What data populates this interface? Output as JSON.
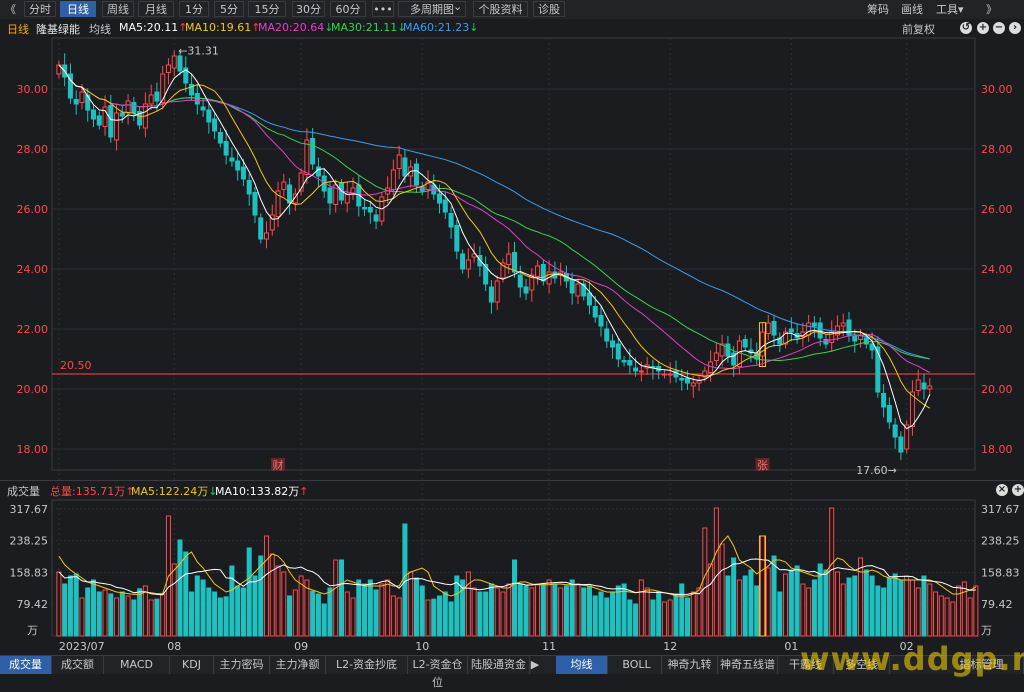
{
  "toolbar": {
    "back_glyph": "《",
    "tabs": [
      "分时",
      "日线",
      "周线",
      "月线",
      "1分",
      "5分",
      "15分",
      "30分",
      "60分",
      "•••",
      "多周期图",
      "个股资料",
      "诊股"
    ],
    "active_tab": 1,
    "dropdown_glyph": "⌄",
    "right_items": [
      "筹码",
      "画线",
      "工具"
    ],
    "tools_caret": "▾",
    "forward_glyph": "》"
  },
  "info": {
    "period": "日线",
    "name": "隆基绿能",
    "ma_label": "均线",
    "ma": [
      {
        "label": "MA5:20.11",
        "arrow": "↑",
        "color": "#ffffff",
        "arrow_color": "#ff3b3b"
      },
      {
        "label": "MA10:19.61",
        "arrow": "↑",
        "color": "#f5c518",
        "arrow_color": "#ff3b3b"
      },
      {
        "label": "MA20:20.64",
        "arrow": "↓",
        "color": "#e040c8",
        "arrow_color": "#22c55e"
      },
      {
        "label": "MA30:21.11",
        "arrow": "↓",
        "color": "#3ccf4e",
        "arrow_color": "#22c55e"
      },
      {
        "label": "MA60:21.23",
        "arrow": "↓",
        "color": "#3b9bf0",
        "arrow_color": "#22c55e"
      }
    ],
    "adjust": "前复权",
    "ctrl_icons": [
      "↺",
      "+",
      "−",
      "›"
    ]
  },
  "volume_info": {
    "label": "成交量",
    "total": "总量:135.71万",
    "total_arrow": "↑",
    "ma5": "MA5:122.24万",
    "ma5_arrow": "↓",
    "ma10": "MA10:133.82万",
    "ma10_arrow": "↑",
    "ctrl_icons": [
      "×",
      "+"
    ]
  },
  "bottom_tabs": {
    "left": [
      "成交量",
      "成交额",
      "MACD",
      "KDJ",
      "主力密码",
      "主力净额",
      "L2-资金抄底",
      "L2-资金仓位",
      "陆股通资金"
    ],
    "left_active": 0,
    "right": [
      "均线",
      "BOLL",
      "神奇九转",
      "神奇五线谱",
      "干霸线",
      "多空线",
      "指标管理"
    ],
    "right_active": 0,
    "arrow": "▶"
  },
  "watermark": "www.ddgp.net",
  "colors": {
    "up": "#ff4848",
    "down": "#1ec0c0",
    "grid": "#2d2e33",
    "axis_text_price": "#ff4848",
    "axis_text_vol": "#c8c8c8"
  },
  "chart_data": [
    {
      "type": "candlestick",
      "y_ticks": [
        18.0,
        20.0,
        22.0,
        24.0,
        26.0,
        28.0,
        30.0
      ],
      "ylim": [
        17.3,
        31.7
      ],
      "x_tick_labels": [
        "2023/07",
        "08",
        "09",
        "10",
        "11",
        "12",
        "01",
        "02"
      ],
      "x_tick_positions": [
        0,
        20,
        42,
        63,
        85,
        106,
        127,
        147
      ],
      "n_bars": 159,
      "high_label": "31.31",
      "low_label": "17.60",
      "ref_line": {
        "value": 20.5,
        "label": "20.50"
      },
      "event_markers": [
        {
          "bar": 38,
          "label": "财"
        },
        {
          "bar": 122,
          "label": "张"
        }
      ],
      "highlight_bar": 122,
      "closes": [
        30.8,
        30.4,
        29.7,
        29.5,
        29.9,
        29.3,
        29.0,
        28.8,
        29.4,
        28.4,
        29.2,
        29.1,
        29.6,
        29.2,
        28.8,
        29.5,
        29.8,
        29.6,
        30.5,
        30.8,
        31.1,
        30.6,
        30.2,
        29.8,
        29.5,
        29.3,
        28.9,
        28.6,
        28.2,
        27.8,
        27.6,
        27.3,
        27.0,
        26.5,
        25.8,
        25.0,
        25.2,
        25.8,
        26.6,
        26.9,
        26.2,
        26.5,
        27.2,
        28.3,
        27.5,
        27.1,
        26.6,
        26.2,
        26.8,
        26.3,
        26.5,
        26.7,
        26.1,
        26.0,
        25.9,
        25.6,
        26.4,
        26.7,
        27.3,
        27.8,
        27.1,
        27.4,
        26.8,
        26.6,
        26.9,
        26.5,
        26.2,
        25.9,
        25.4,
        24.6,
        24.0,
        24.3,
        24.5,
        24.1,
        23.5,
        22.9,
        23.6,
        24.2,
        24.5,
        23.9,
        23.4,
        23.2,
        23.8,
        24.1,
        23.6,
        23.9,
        23.7,
        23.9,
        23.6,
        23.2,
        23.5,
        23.1,
        22.8,
        22.4,
        22.1,
        21.6,
        21.4,
        21.0,
        20.9,
        20.8,
        20.6,
        20.6,
        20.8,
        20.7,
        20.6,
        20.5,
        20.5,
        20.4,
        20.3,
        20.2,
        20.2,
        20.3,
        20.6,
        20.9,
        21.2,
        21.5,
        21.1,
        20.8,
        21.6,
        21.4,
        21.2,
        21.0,
        21.9,
        22.2,
        21.8,
        21.5,
        21.9,
        21.9,
        21.7,
        21.9,
        22.2,
        22.1,
        21.7,
        21.5,
        21.9,
        22.1,
        22.2,
        21.8,
        21.6,
        21.8,
        21.5,
        21.3,
        19.9,
        19.4,
        18.9,
        18.4,
        17.9,
        18.8,
        19.9,
        20.3,
        20.0,
        20.1
      ]
    },
    {
      "type": "bar",
      "series_name": "成交量",
      "unit": "万",
      "y_ticks": [
        79.42,
        158.83,
        238.25,
        317.67
      ],
      "ylim": [
        0,
        340
      ],
      "values": [
        160,
        130,
        150,
        155,
        95,
        120,
        140,
        110,
        115,
        105,
        95,
        110,
        100,
        90,
        118,
        125,
        90,
        92,
        105,
        300,
        180,
        240,
        210,
        110,
        150,
        140,
        120,
        110,
        95,
        98,
        175,
        125,
        120,
        220,
        150,
        200,
        250,
        205,
        175,
        160,
        100,
        115,
        150,
        140,
        112,
        105,
        80,
        120,
        190,
        190,
        110,
        95,
        140,
        130,
        140,
        115,
        130,
        140,
        100,
        95,
        280,
        160,
        145,
        125,
        90,
        92,
        100,
        110,
        85,
        150,
        140,
        160,
        120,
        110,
        110,
        130,
        120,
        110,
        130,
        190,
        130,
        125,
        120,
        130,
        130,
        140,
        130,
        120,
        125,
        140,
        130,
        120,
        125,
        100,
        110,
        95,
        110,
        125,
        130,
        90,
        80,
        140,
        120,
        90,
        110,
        85,
        90,
        105,
        130,
        95,
        110,
        120,
        270,
        180,
        320,
        230,
        150,
        195,
        140,
        150,
        165,
        125,
        250,
        170,
        200,
        110,
        155,
        165,
        175,
        130,
        120,
        140,
        180,
        165,
        320,
        160,
        130,
        145,
        150,
        195,
        165,
        150,
        125,
        120,
        145,
        155,
        140,
        150,
        140,
        120,
        150,
        130,
        110,
        100,
        95,
        85,
        125,
        135,
        95,
        125
      ],
      "vol_ma5": [
        200,
        178,
        165,
        155,
        145,
        135,
        130,
        125,
        120,
        115,
        110,
        108,
        106,
        104,
        104,
        110,
        108,
        106,
        106,
        150,
        165,
        180,
        200,
        210,
        185,
        170,
        150,
        130,
        120,
        110,
        115,
        125,
        135,
        145,
        160,
        175,
        190,
        205,
        200,
        185,
        160,
        140,
        130,
        120,
        115,
        110,
        105,
        110,
        120,
        130,
        140,
        135,
        130,
        125,
        125,
        125,
        125,
        130,
        125,
        125,
        150,
        160,
        165,
        170,
        160,
        125,
        115,
        105,
        100,
        105,
        115,
        130,
        140,
        140,
        135,
        130,
        125,
        120,
        120,
        130,
        135,
        135,
        130,
        128,
        128,
        128,
        130,
        130,
        128,
        128,
        128,
        127,
        125,
        120,
        115,
        110,
        110,
        110,
        112,
        110,
        108,
        110,
        115,
        115,
        112,
        108,
        105,
        100,
        100,
        100,
        105,
        115,
        150,
        175,
        210,
        235,
        250,
        225,
        190,
        180,
        170,
        155,
        165,
        175,
        190,
        190,
        185,
        170,
        165,
        160,
        155,
        150,
        150,
        160,
        180,
        195,
        190,
        175,
        165,
        160,
        160,
        165,
        160,
        150,
        145,
        145,
        140,
        140,
        140,
        140,
        140,
        140,
        135,
        125,
        115,
        105,
        105,
        110,
        115,
        122
      ]
    }
  ]
}
